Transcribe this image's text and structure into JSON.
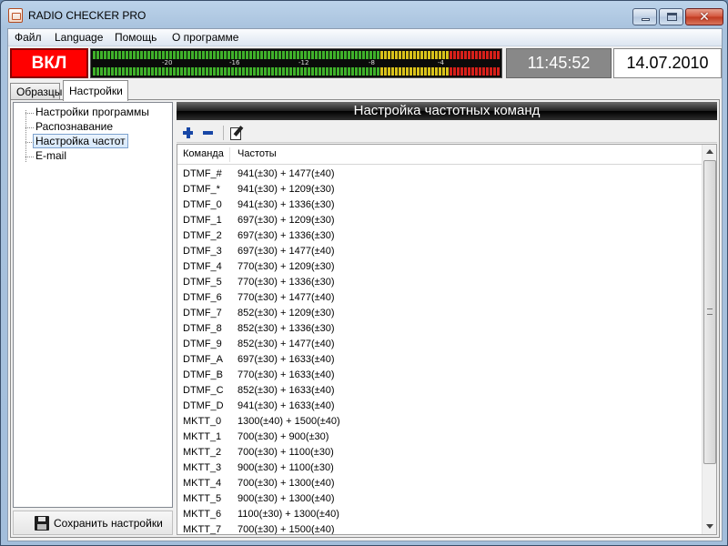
{
  "window": {
    "title": "RADIO CHECKER PRO",
    "close_glyph": "✕"
  },
  "menu": [
    "Файл",
    "Language",
    "Помощь",
    "О программе"
  ],
  "status": {
    "on_label": "ВКЛ",
    "time": "11:45:52",
    "date": "14.07.2010",
    "meter_ticks": [
      "-20",
      "-16",
      "-12",
      "-8",
      "-4"
    ]
  },
  "tabs": [
    {
      "label": "Образцы",
      "active": false
    },
    {
      "label": "Настройки",
      "active": true
    }
  ],
  "tree": {
    "items": [
      {
        "label": "Настройки программы",
        "selected": false
      },
      {
        "label": "Распознавание",
        "selected": false
      },
      {
        "label": "Настройка частот",
        "selected": true
      },
      {
        "label": "E-mail",
        "selected": false
      }
    ]
  },
  "save_button": {
    "label": "Сохранить настройки",
    "icon": "floppy-icon"
  },
  "panel": {
    "title": "Настройка частотных команд",
    "toolbar": {
      "add_icon": "plus-icon",
      "remove_icon": "minus-icon",
      "edit_icon": "edit-icon"
    },
    "columns": [
      "Команда",
      "Частоты"
    ],
    "rows": [
      [
        "DTMF_#",
        "941(±30) + 1477(±40)"
      ],
      [
        "DTMF_*",
        "941(±30) + 1209(±30)"
      ],
      [
        "DTMF_0",
        "941(±30) + 1336(±30)"
      ],
      [
        "DTMF_1",
        "697(±30) + 1209(±30)"
      ],
      [
        "DTMF_2",
        "697(±30) + 1336(±30)"
      ],
      [
        "DTMF_3",
        "697(±30) + 1477(±40)"
      ],
      [
        "DTMF_4",
        "770(±30) + 1209(±30)"
      ],
      [
        "DTMF_5",
        "770(±30) + 1336(±30)"
      ],
      [
        "DTMF_6",
        "770(±30) + 1477(±40)"
      ],
      [
        "DTMF_7",
        "852(±30) + 1209(±30)"
      ],
      [
        "DTMF_8",
        "852(±30) + 1336(±30)"
      ],
      [
        "DTMF_9",
        "852(±30) + 1477(±40)"
      ],
      [
        "DTMF_A",
        "697(±30) + 1633(±40)"
      ],
      [
        "DTMF_B",
        "770(±30) + 1633(±40)"
      ],
      [
        "DTMF_C",
        "852(±30) + 1633(±40)"
      ],
      [
        "DTMF_D",
        "941(±30) + 1633(±40)"
      ],
      [
        "MKTT_0",
        "1300(±40) + 1500(±40)"
      ],
      [
        "MKTT_1",
        "700(±30) + 900(±30)"
      ],
      [
        "MKTT_2",
        "700(±30) + 1100(±30)"
      ],
      [
        "MKTT_3",
        "900(±30) + 1100(±30)"
      ],
      [
        "MKTT_4",
        "700(±30) + 1300(±40)"
      ],
      [
        "MKTT_5",
        "900(±30) + 1300(±40)"
      ],
      [
        "MKTT_6",
        "1100(±30) + 1300(±40)"
      ],
      [
        "MKTT_7",
        "700(±30) + 1500(±40)"
      ]
    ]
  },
  "colors": {
    "on_red": "#ff0000",
    "meter_green": "#3fb02a",
    "meter_yellow": "#d9c21a",
    "meter_red": "#d7201a",
    "panel_header": "#000000",
    "selection": "#d6e8fb"
  }
}
